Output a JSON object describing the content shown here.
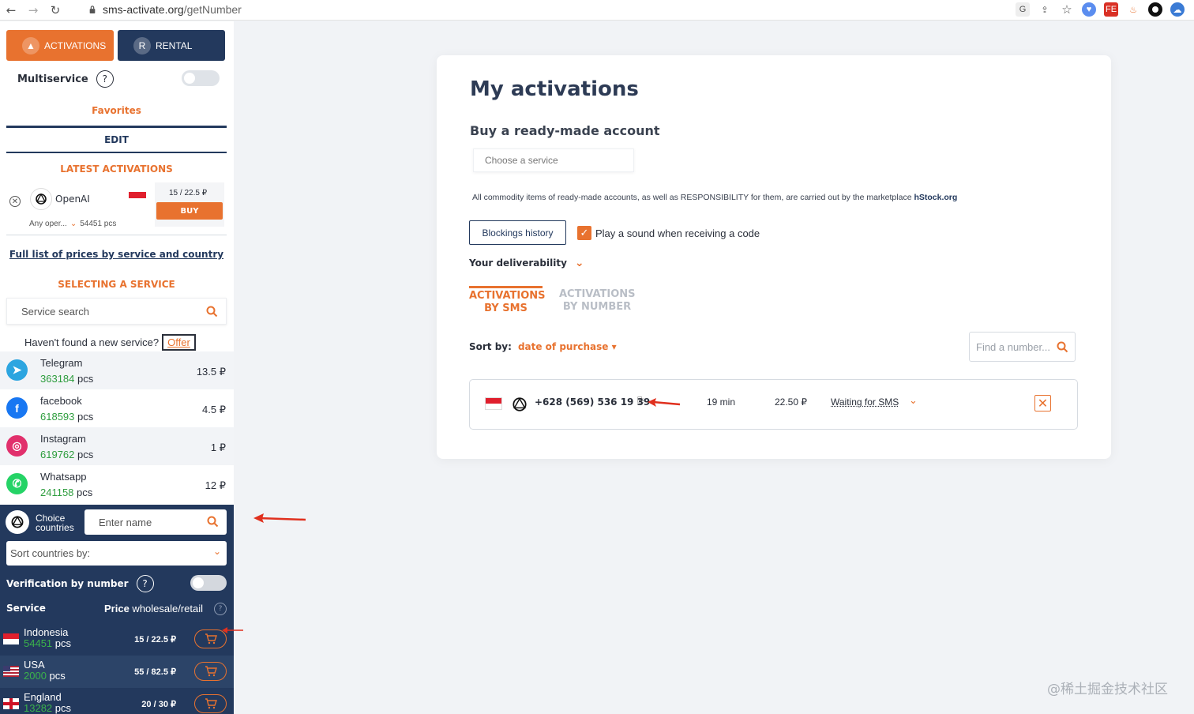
{
  "browser": {
    "url_domain": "sms-activate.org",
    "url_path": "/getNumber"
  },
  "sidebar": {
    "tabs": [
      {
        "label": "ACTIVATIONS"
      },
      {
        "label": "RENTAL"
      }
    ],
    "multiservice_label": "Multiservice",
    "help_glyph": "?",
    "favorites_label": "Favorites",
    "edit_label": "EDIT",
    "latest_title": "LATEST ACTIVATIONS",
    "latest_item": {
      "service": "OpenAI",
      "price": "15 / 22.5 ₽",
      "buy_label": "BUY",
      "operator": "Any oper...",
      "count": "54451 pcs"
    },
    "full_list_link": "Full list of prices by service and country",
    "selecting_title": "SELECTING A SERVICE",
    "service_search_placeholder": "Service search",
    "not_found_text": "Haven't found a new service?",
    "offer_label": "Offer",
    "services": [
      {
        "name": "Telegram",
        "count": "363184",
        "pcs": "pcs",
        "price": "13.5 ₽",
        "icon": "telegram-icon",
        "color": "#2ca5e0"
      },
      {
        "name": "facebook",
        "count": "618593",
        "pcs": "pcs",
        "price": "4.5 ₽",
        "icon": "facebook-icon",
        "color": "#1877f2"
      },
      {
        "name": "Instagram",
        "count": "619762",
        "pcs": "pcs",
        "price": "1 ₽",
        "icon": "instagram-icon",
        "color": "#e1306c"
      },
      {
        "name": "Whatsapp",
        "count": "241158",
        "pcs": "pcs",
        "price": "12 ₽",
        "icon": "whatsapp-icon",
        "color": "#25d366"
      }
    ]
  },
  "country_panel": {
    "choice_label": "Choice countries",
    "name_placeholder": "Enter name",
    "sort_label": "Sort countries by:",
    "verification_label": "Verification by number",
    "help_glyph": "?",
    "header_service": "Service",
    "header_price_bold": "Price",
    "header_price_rest": " wholesale/retail",
    "header_help": "?",
    "countries": [
      {
        "name": "Indonesia",
        "count": "54451",
        "pcs": "pcs",
        "price": "15 / 22.5 ₽"
      },
      {
        "name": "USA",
        "count": "2000",
        "pcs": "pcs",
        "price": "55 / 82.5 ₽"
      },
      {
        "name": "England",
        "count": "13282",
        "pcs": "pcs",
        "price": "20 / 30 ₽"
      }
    ]
  },
  "main": {
    "title": "My activations",
    "buy_account_title": "Buy a ready-made account",
    "choose_service_placeholder": "Choose a service",
    "commodity_text": "All commodity items of ready-made accounts, as well as RESPONSIBILITY for them, are carried out by the marketplace ",
    "commodity_link": "hStock.org",
    "blockings_label": "Blockings history",
    "sound_label": "Play a sound when receiving a code",
    "check_glyph": "✓",
    "deliverability_label": "Your deliverability",
    "tab_sms_line1": "ACTIVATIONS",
    "tab_sms_line2": "BY SMS",
    "tab_num_line1": "ACTIVATIONS",
    "tab_num_line2": "BY NUMBER",
    "sort_by_label": "Sort by:",
    "sort_by_value": "date of purchase",
    "find_number_placeholder": "Find a number...",
    "activation": {
      "phone": "+628 (569) 536 19 39",
      "time": "19 min",
      "price": "22.50 ₽",
      "status": "Waiting for SMS"
    }
  },
  "watermark": "@稀土掘金技术社区",
  "colors": {
    "accent": "#e8722f",
    "navy": "#23395d",
    "green": "#2e9d3e"
  }
}
